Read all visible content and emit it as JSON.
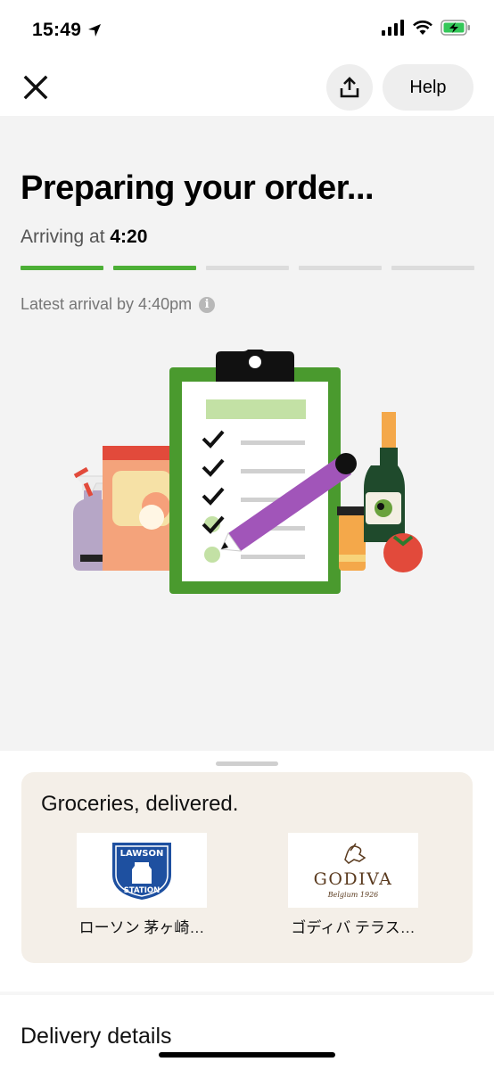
{
  "status_bar": {
    "time": "15:49"
  },
  "toolbar": {
    "help_label": "Help"
  },
  "order": {
    "title": "Preparing your order...",
    "arriving_prefix": "Arriving at",
    "arriving_time": "4:20",
    "progress_completed": 2,
    "progress_total": 5,
    "latest_arrival": "Latest arrival by 4:40pm"
  },
  "promo": {
    "title": "Groceries, delivered.",
    "stores": [
      {
        "name": "ローソン 茅ヶ崎…",
        "logo_lines": [
          "LAWSON",
          "STATION"
        ]
      },
      {
        "name": "ゴディバ テラス…",
        "logo_lines": [
          "GODIVA",
          "Belgium 1926"
        ]
      }
    ]
  },
  "details": {
    "title": "Delivery details"
  },
  "colors": {
    "accent_green": "#4caf36",
    "lawson_blue": "#1e50a0",
    "godiva_brown": "#5a3a1e"
  }
}
